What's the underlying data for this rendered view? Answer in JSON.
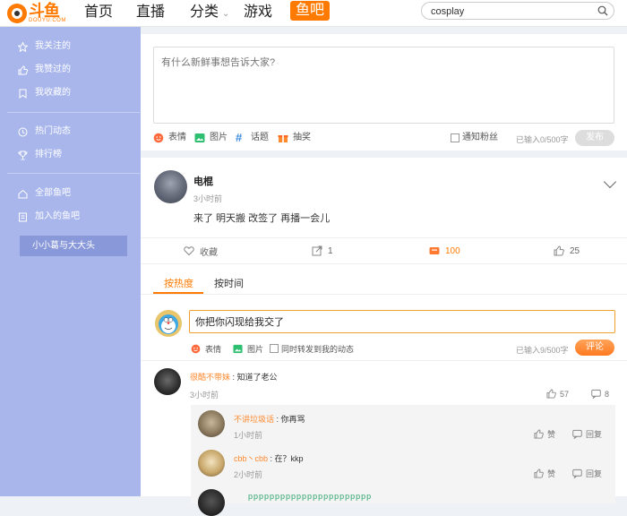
{
  "topbar": {
    "logo_text": "斗鱼",
    "logo_sub": "DOUYU.COM",
    "nav": [
      "首页",
      "直播",
      "分类",
      "游戏"
    ],
    "nav_active": "鱼吧",
    "search_value": "cosplay"
  },
  "sidebar": {
    "group1": [
      "我关注的",
      "我赞过的",
      "我收藏的"
    ],
    "group2": [
      "热门动态",
      "排行榜"
    ],
    "group3": [
      "全部鱼吧",
      "加入的鱼吧"
    ],
    "sub_item": "小小葛与大大头"
  },
  "composer": {
    "placeholder": "有什么新鲜事想告诉大家?",
    "tools": [
      "表情",
      "图片",
      "话题",
      "抽奖"
    ],
    "notify_fans": "通知粉丝",
    "char_count": "已输入0/500字",
    "publish": "发布"
  },
  "post": {
    "user": "电棍",
    "time": "3小时前",
    "text": "来了  明天搬  改签了 再播一会儿",
    "actions": {
      "collect": "收藏",
      "share": "1",
      "gift": "100",
      "like": "25"
    },
    "tabs": [
      "按热度",
      "按时间"
    ],
    "reply": {
      "value": "你把你闪现给我交了",
      "tools": [
        "表情",
        "图片"
      ],
      "forward": "同时转发到我的动态",
      "char_count": "已输入9/500字",
      "submit": "评论"
    },
    "comment": {
      "name": "很酷不带妹",
      "text": "知道了老公",
      "time": "3小时前",
      "likes": "57",
      "replies": "8"
    },
    "sub_replies": [
      {
        "name": "不讲垃圾话",
        "text": "你再骂",
        "time": "1小时前",
        "like": "赞",
        "reply": "回复"
      },
      {
        "name": "cbb丶cbb",
        "text": "在？kkp",
        "time": "2小时前",
        "like": "赞",
        "reply": "回复"
      }
    ],
    "garbled_line": "ppppppppppppppppppppppp"
  },
  "colors": {
    "accent": "#ff7a00",
    "sidebar": "#a8b6ec",
    "link": "#ff8a30"
  }
}
